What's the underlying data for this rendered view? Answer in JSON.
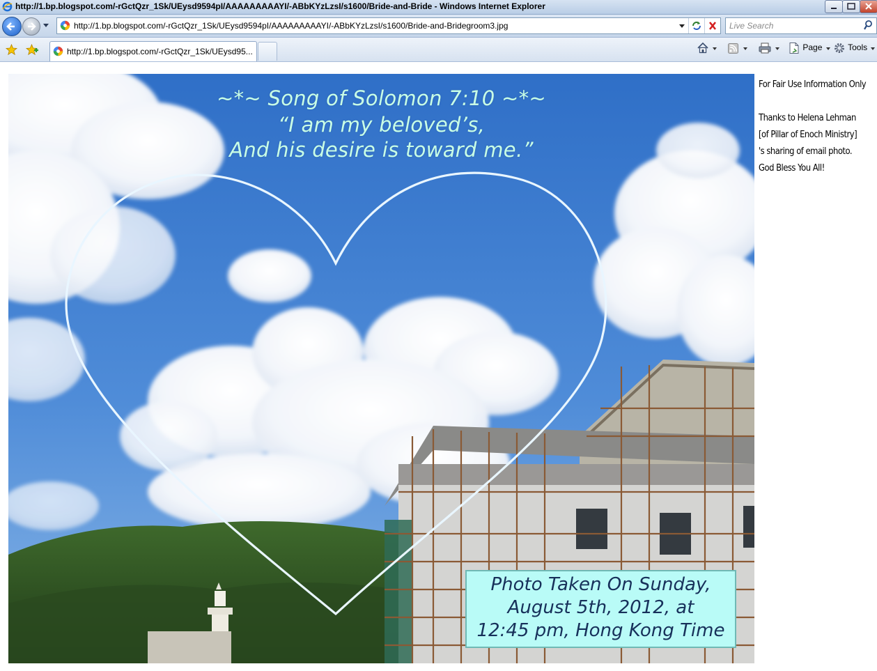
{
  "window": {
    "title": "http://1.bp.blogspot.com/-rGctQzr_1Sk/UEysd9594pI/AAAAAAAAAYI/-ABbKYzLzsI/s1600/Bride-and-Bride - Windows Internet Explorer",
    "logo_icon": "ie-logo-icon",
    "controls": [
      "minimize-icon",
      "maximize-icon",
      "close-icon"
    ]
  },
  "address_bar": {
    "url": "http://1.bp.blogspot.com/-rGctQzr_1Sk/UEysd9594pI/AAAAAAAAAYI/-ABbKYzLzsI/s1600/Bride-and-Bridegroom3.jpg",
    "site_icon": "picasa-icon"
  },
  "search": {
    "placeholder": "Live Search"
  },
  "tab": {
    "label": "http://1.bp.blogspot.com/-rGctQzr_1Sk/UEysd95..."
  },
  "command_bar": {
    "page_label": "Page",
    "tools_label": "Tools"
  },
  "photo": {
    "verse_line1": "~*~ Song of Solomon 7:10 ~*~",
    "verse_line2": "“I am my beloved’s,",
    "verse_line3": "And his desire is toward me.”",
    "caption_line1": "Photo Taken On Sunday,",
    "caption_line2": "August 5th, 2012, at",
    "caption_line3": "12:45 pm, Hong Kong Time"
  },
  "sidenote": {
    "line1": "For Fair Use Information Only",
    "line2": "Thanks to Helena Lehman",
    "line3": "[of Pillar of Enoch Ministry]",
    "line4": "'s sharing of email photo.",
    "line5": "God Bless You All!"
  },
  "colors": {
    "sky": "#3f7fd0",
    "verse_text": "#c9ffe6",
    "caption_bg": "#b9fbf7",
    "chrome": "#c6d6ea"
  }
}
